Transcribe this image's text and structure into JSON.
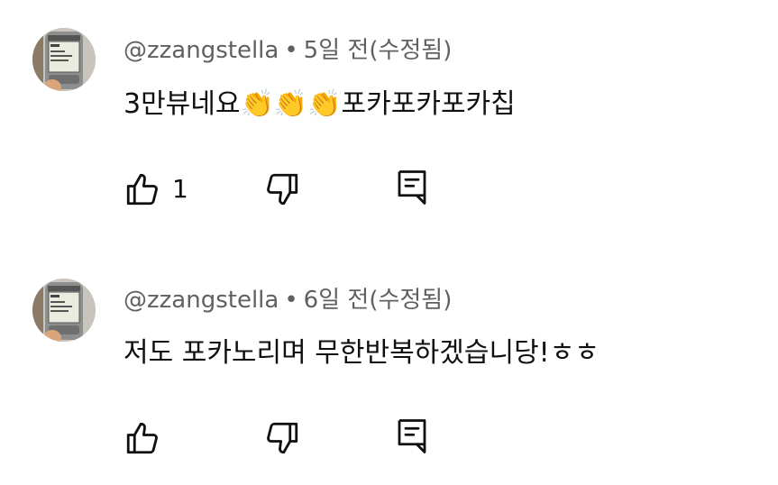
{
  "comments": [
    {
      "author": "@zzangstella",
      "separator": "•",
      "time": "5일 전(수정됨)",
      "text": "3만뷰네요👏👏👏포카포카포카칩",
      "like_count": "1",
      "icons": {
        "like": "thumb-up-icon",
        "dislike": "thumb-down-icon",
        "reply": "reply-comment-icon"
      }
    },
    {
      "author": "@zzangstella",
      "separator": "•",
      "time": "6일 전(수정됨)",
      "text": "저도 포카노리며 무한반복하겠습니당!ㅎㅎ",
      "like_count": "",
      "icons": {
        "like": "thumb-up-icon",
        "dislike": "thumb-down-icon",
        "reply": "reply-comment-icon"
      }
    }
  ],
  "avatar": {
    "description_icon": "phone-screen-avatar-icon",
    "screen_lines": [
      "무신",
      "입신용 폰",
      "출장정의..."
    ]
  },
  "colors": {
    "text_primary": "#0f0f0f",
    "text_secondary": "#606060",
    "background": "#ffffff"
  }
}
